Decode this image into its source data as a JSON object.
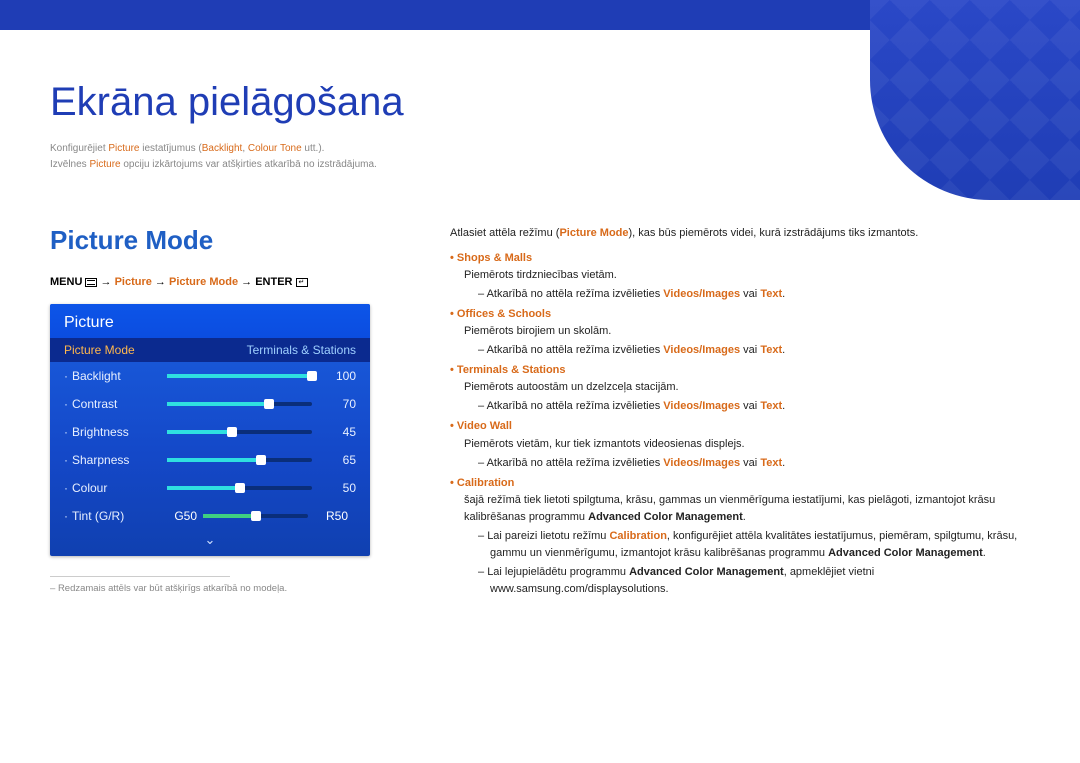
{
  "page": {
    "title": "Ekrāna pielāgošana",
    "subline1_parts": [
      "Konfigurējiet ",
      "Picture",
      " iestatījumus (",
      "Backlight",
      ", ",
      "Colour Tone",
      " utt.)."
    ],
    "subline2_parts": [
      "Izvēlnes ",
      "Picture",
      " opciju izkārtojums var atšķirties atkarībā no izstrādājuma."
    ]
  },
  "section": {
    "heading": "Picture Mode",
    "breadcrumb_parts": [
      "MENU",
      " → ",
      "Picture",
      " → ",
      "Picture Mode",
      " → ",
      "ENTER"
    ],
    "footnote": "Redzamais attēls var būt atšķirīgs atkarībā no modeļa."
  },
  "osd": {
    "panel_title": "Picture",
    "mode_label": "Picture Mode",
    "mode_value": "Terminals & Stations",
    "items": [
      {
        "label": "Backlight",
        "value": 100,
        "percent": 100
      },
      {
        "label": "Contrast",
        "value": 70,
        "percent": 70
      },
      {
        "label": "Brightness",
        "value": 45,
        "percent": 45
      },
      {
        "label": "Sharpness",
        "value": 65,
        "percent": 65
      },
      {
        "label": "Colour",
        "value": 50,
        "percent": 50
      }
    ],
    "tint": {
      "label": "Tint (G/R)",
      "g": "G50",
      "r": "R50",
      "g_percent": 50
    }
  },
  "right": {
    "intro_parts": [
      "Atlasiet attēla režīmu (",
      "Picture Mode",
      "), kas būs piemērots videi, kurā izstrādājums tiks izmantots."
    ],
    "modes": [
      {
        "name": "Shops & Malls",
        "desc": "Piemērots tirdzniecības vietām.",
        "subs": [
          {
            "parts": [
              "Atkarībā no attēla režīma izvēlieties ",
              {
                "hl": "Videos/Images"
              },
              " vai ",
              {
                "hl": "Text"
              },
              "."
            ]
          }
        ]
      },
      {
        "name": "Offices & Schools",
        "desc": "Piemērots birojiem un skolām.",
        "subs": [
          {
            "parts": [
              "Atkarībā no attēla režīma izvēlieties ",
              {
                "hl": "Videos/Images"
              },
              " vai ",
              {
                "hl": "Text"
              },
              "."
            ]
          }
        ]
      },
      {
        "name": "Terminals & Stations",
        "desc": "Piemērots autoostām un dzelzceļa stacijām.",
        "subs": [
          {
            "parts": [
              "Atkarībā no attēla režīma izvēlieties ",
              {
                "hl": "Videos/Images"
              },
              " vai ",
              {
                "hl": "Text"
              },
              "."
            ]
          }
        ]
      },
      {
        "name": "Video Wall",
        "desc": "Piemērots vietām, kur tiek izmantots videosienas displejs.",
        "subs": [
          {
            "parts": [
              "Atkarībā no attēla režīma izvēlieties ",
              {
                "hl": "Videos/Images"
              },
              " vai ",
              {
                "hl": "Text"
              },
              "."
            ]
          }
        ]
      },
      {
        "name": "Calibration",
        "desc": "šajā režīmā tiek lietoti spilgtuma, krāsu, gammas un vienmērīguma iestatījumi, kas pielāgoti, izmantojot krāsu kalibrēšanas programmu Advanced Color Management.",
        "desc_bold_tail": "Advanced Color Management",
        "subs": [
          {
            "parts": [
              "Lai pareizi lietotu režīmu ",
              {
                "hl": "Calibration"
              },
              ", konfigurējiet attēla kvalitātes iestatījumus, piemēram, spilgtumu, krāsu, gammu un vienmērīgumu, izmantojot krāsu kalibrēšanas programmu ",
              {
                "bold": "Advanced Color Management"
              },
              "."
            ]
          },
          {
            "parts": [
              "Lai lejupielādētu programmu ",
              {
                "bold": "Advanced Color Management"
              },
              ", apmeklējiet vietni www.samsung.com/displaysolutions."
            ]
          }
        ]
      }
    ]
  }
}
